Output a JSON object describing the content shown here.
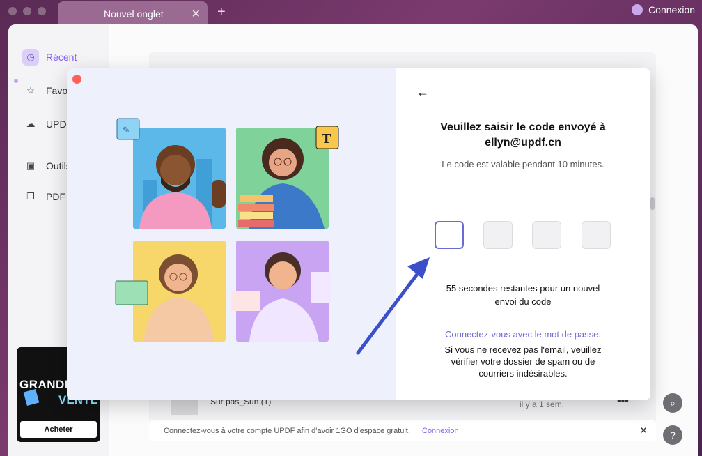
{
  "browser": {
    "tab_title": "Nouvel onglet",
    "login_label": "Connexion"
  },
  "sidebar": {
    "items": [
      {
        "label": "Récent"
      },
      {
        "label": "Favor"
      },
      {
        "label": "UPDF"
      },
      {
        "label": "Outils"
      },
      {
        "label": "PDF e"
      }
    ]
  },
  "promo": {
    "line1": "GRANDE",
    "line2": "VENTE",
    "buy_label": "Acheter"
  },
  "file_row": {
    "name": "Sur pas_Sun (1)",
    "time": "il y a 1 sem."
  },
  "bottom_bar": {
    "message": "Connectez-vous à votre compte UPDF afin d'avoir 1GO d'espace gratuit.",
    "link": "Connexion"
  },
  "modal": {
    "title_line1": "Veuillez saisir le code envoyé à",
    "title_line2": "ellyn@updf.cn",
    "subtitle": "Le code est valable pendant 10 minutes.",
    "code_boxes": [
      "",
      "",
      "",
      ""
    ],
    "timer_text": "55 secondes restantes pour un nouvel envoi du code",
    "password_link": "Connectez-vous avec le mot de passe.",
    "spam_text": "Si vous ne recevez pas l'email, veuillez vérifier votre dossier de spam ou de courriers indésirables."
  },
  "colors": {
    "accent": "#8b5cf6",
    "link": "#6b6bd6",
    "arrow": "#3b4fc9"
  }
}
